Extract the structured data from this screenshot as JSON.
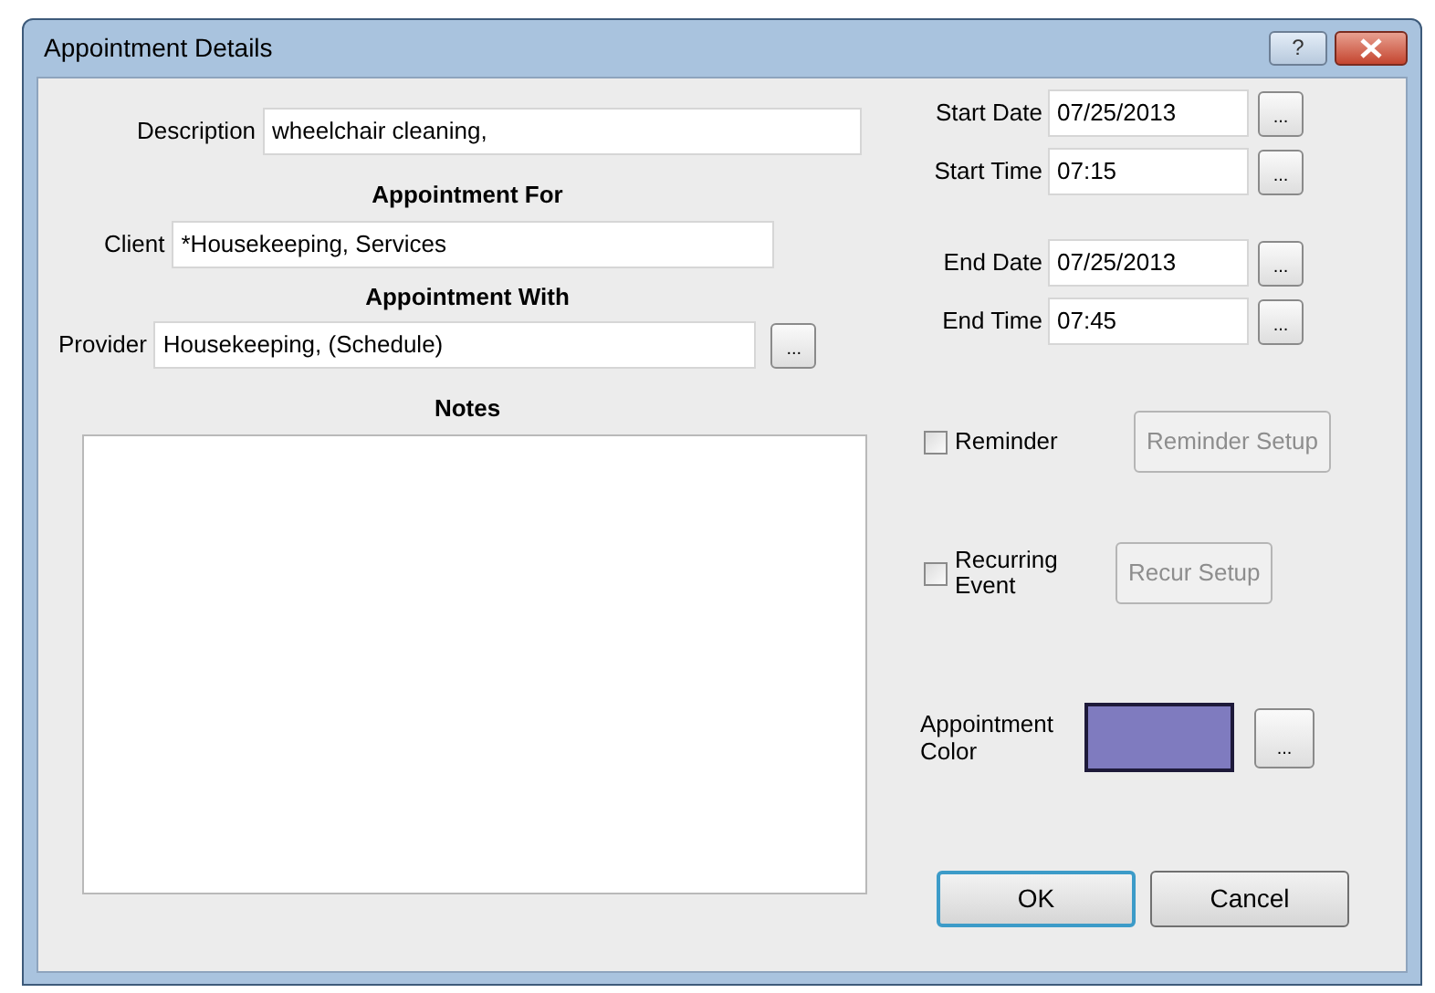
{
  "window": {
    "title": "Appointment Details",
    "help": "?"
  },
  "description": {
    "label": "Description",
    "value": "wheelchair cleaning,"
  },
  "sections": [
    {
      "heading": "Appointment For",
      "label": "Client",
      "value": "*Housekeeping, Services"
    },
    {
      "heading": "Appointment With",
      "label": "Provider",
      "value": "Housekeeping,  (Schedule)",
      "button": "..."
    }
  ],
  "notes": {
    "heading": "Notes"
  },
  "schedule": [
    {
      "label": "Start Date",
      "value": "07/25/2013",
      "button": "..."
    },
    {
      "label": "Start Time",
      "value": "07:15",
      "button": "..."
    },
    {
      "label": "End Date",
      "value": "07/25/2013",
      "button": "..."
    },
    {
      "label": "End Time",
      "value": "07:45",
      "button": "..."
    }
  ],
  "options": [
    {
      "label": "Reminder",
      "checked": false,
      "button": "Reminder Setup",
      "button_disabled": true
    },
    {
      "label": "Recurring Event",
      "checked": false,
      "button": "Recur Setup",
      "button_disabled": true
    }
  ],
  "appointment_color": {
    "label": "Appointment Color",
    "color": "#7f7bbf",
    "button": "..."
  },
  "buttons": [
    {
      "label": "OK",
      "default": true
    },
    {
      "label": "Cancel",
      "default": false
    }
  ]
}
